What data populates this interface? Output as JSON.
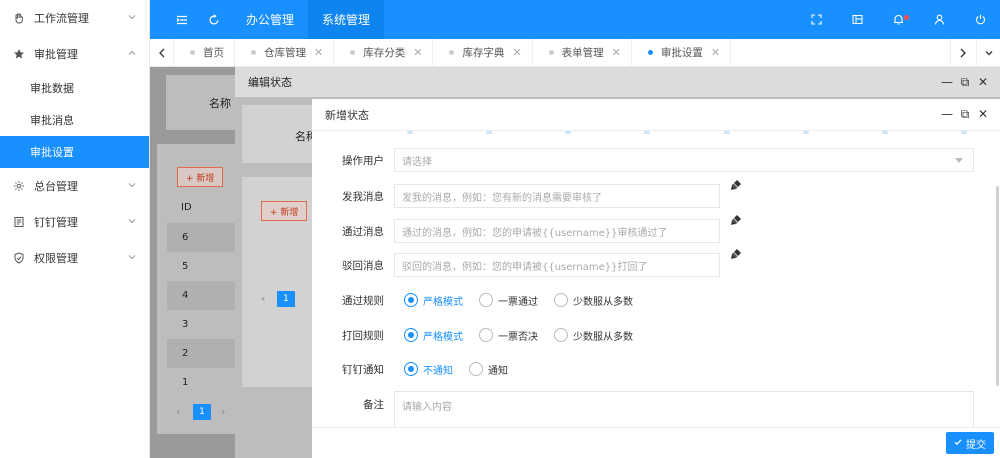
{
  "sidebar": {
    "items": [
      {
        "label": "工作流管理",
        "icon": "hand-icon",
        "expanded": false
      },
      {
        "label": "审批管理",
        "icon": "star-icon",
        "expanded": true,
        "children": [
          {
            "label": "审批数据",
            "active": false
          },
          {
            "label": "审批消息",
            "active": false
          },
          {
            "label": "审批设置",
            "active": true
          }
        ]
      },
      {
        "label": "总台管理",
        "icon": "gear-icon",
        "expanded": false
      },
      {
        "label": "钉钉管理",
        "icon": "document-icon",
        "expanded": false
      },
      {
        "label": "权限管理",
        "icon": "shield-icon",
        "expanded": false
      }
    ]
  },
  "header": {
    "nav": [
      {
        "label": "办公管理",
        "active": false
      },
      {
        "label": "系统管理",
        "active": true
      }
    ],
    "accent": "#1890ff"
  },
  "tabs": [
    {
      "label": "首页",
      "closable": false,
      "active": false
    },
    {
      "label": "仓库管理",
      "closable": true,
      "active": false
    },
    {
      "label": "库存分类",
      "closable": true,
      "active": false
    },
    {
      "label": "库存字典",
      "closable": true,
      "active": false
    },
    {
      "label": "表单管理",
      "closable": true,
      "active": false
    },
    {
      "label": "审批设置",
      "closable": true,
      "active": true
    }
  ],
  "background_page": {
    "filter_label": "名称",
    "add_button": "+ 新增",
    "id_header": "ID",
    "ids": [
      "6",
      "5",
      "4",
      "3",
      "2",
      "1"
    ],
    "page": "1"
  },
  "dialog_edit": {
    "title": "编辑状态",
    "filter_label": "名称",
    "add_button": "+ 新增",
    "page": "1"
  },
  "dialog_new": {
    "title": "新增状态",
    "fields": {
      "operator": {
        "label": "操作用户",
        "placeholder": "请选择"
      },
      "send_msg": {
        "label": "发我消息",
        "placeholder": "发我的消息，例如：您有新的消息需要审核了"
      },
      "pass_msg": {
        "label": "通过消息",
        "placeholder": "通过的消息，例如：您的申请被{{username}}审核通过了"
      },
      "reject_msg": {
        "label": "驳回消息",
        "placeholder": "驳回的消息，例如：您的申请被{{username}}打回了"
      },
      "pass_rule": {
        "label": "通过规则",
        "options": [
          "严格模式",
          "一票通过",
          "少数服从多数"
        ],
        "selected": 0
      },
      "reject_rule": {
        "label": "打回规则",
        "options": [
          "严格模式",
          "一票否决",
          "少数服从多数"
        ],
        "selected": 0
      },
      "dingtalk": {
        "label": "钉钉通知",
        "options": [
          "不通知",
          "通知"
        ],
        "selected": 0
      },
      "remark": {
        "label": "备注",
        "placeholder": "请输入内容"
      }
    },
    "submit": "提交"
  }
}
